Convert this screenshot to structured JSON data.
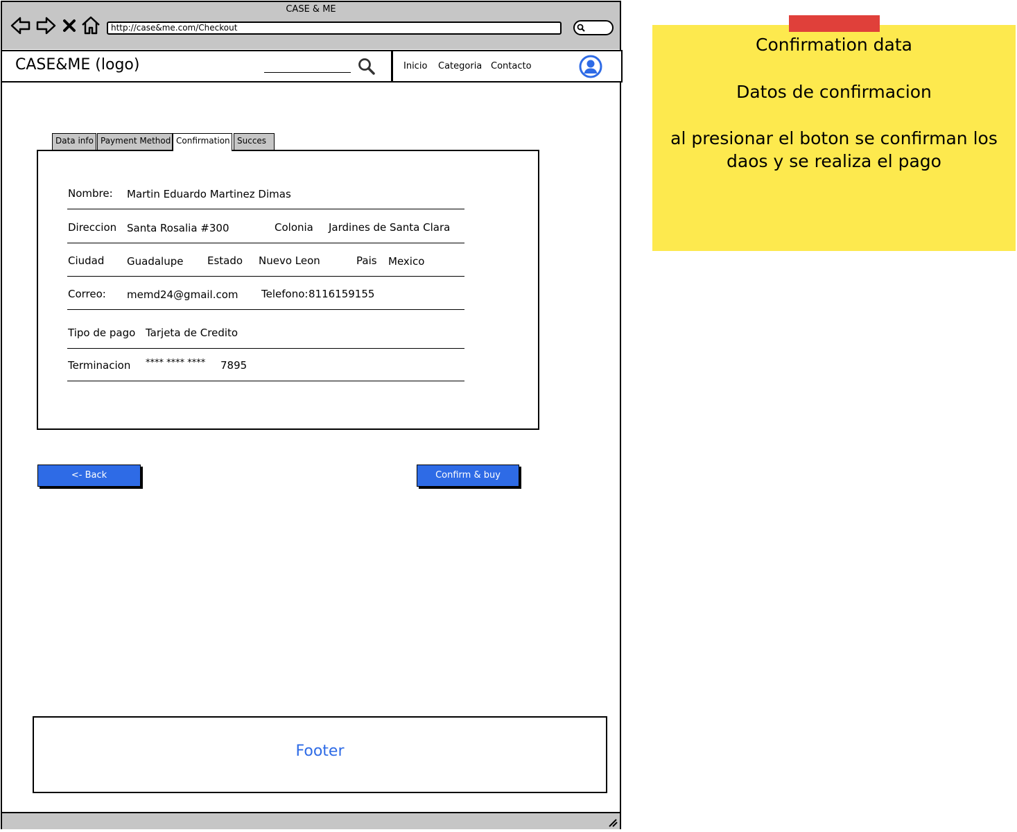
{
  "browser": {
    "window_title": "CASE & ME",
    "url": "http://case&me.com/Checkout",
    "nav_icons": [
      "back-icon",
      "forward-icon",
      "close-icon",
      "home-icon",
      "search-icon"
    ]
  },
  "header": {
    "logo": "CASE&ME (logo)",
    "search_icon": "search-icon",
    "nav": [
      "Inicio",
      "Categoria",
      "Contacto"
    ],
    "user_icon": "user-avatar-icon"
  },
  "tabs": [
    {
      "label": "Data info",
      "active": false
    },
    {
      "label": "Payment Method",
      "active": false
    },
    {
      "label": "Confirmation",
      "active": true
    },
    {
      "label": "Succes",
      "active": false
    }
  ],
  "confirmation": {
    "nombre_label": "Nombre:",
    "nombre_value": "Martin Eduardo Martinez Dimas",
    "direccion_label": "Direccion",
    "direccion_value": "Santa Rosalia #300",
    "colonia_label": "Colonia",
    "colonia_value": "Jardines de Santa Clara",
    "ciudad_label": "Ciudad",
    "ciudad_value": "Guadalupe",
    "estado_label": "Estado",
    "estado_value": "Nuevo Leon",
    "pais_label": "Pais",
    "pais_value": "Mexico",
    "correo_label": "Correo:",
    "correo_value": "memd24@gmail.com",
    "telefono_label": "Telefono:",
    "telefono_value": "8116159155",
    "tipo_pago_label": "Tipo de pago",
    "tipo_pago_value": "Tarjeta de Credito",
    "terminacion_label": "Terminacion",
    "terminacion_mask": "**** **** ****",
    "terminacion_value": "7895"
  },
  "buttons": {
    "back": "<- Back",
    "confirm": "Confirm & buy"
  },
  "footer": "Footer",
  "note": {
    "title": "Confirmation data",
    "subtitle": "Datos de confirmacion",
    "line1": "al presionar el boton se confirman los",
    "line2": "daos y se realiza el pago"
  },
  "colors": {
    "accent": "#2e6be6",
    "note": "#fde94e",
    "tape": "#e0403a",
    "chrome": "#c6c6c6"
  }
}
